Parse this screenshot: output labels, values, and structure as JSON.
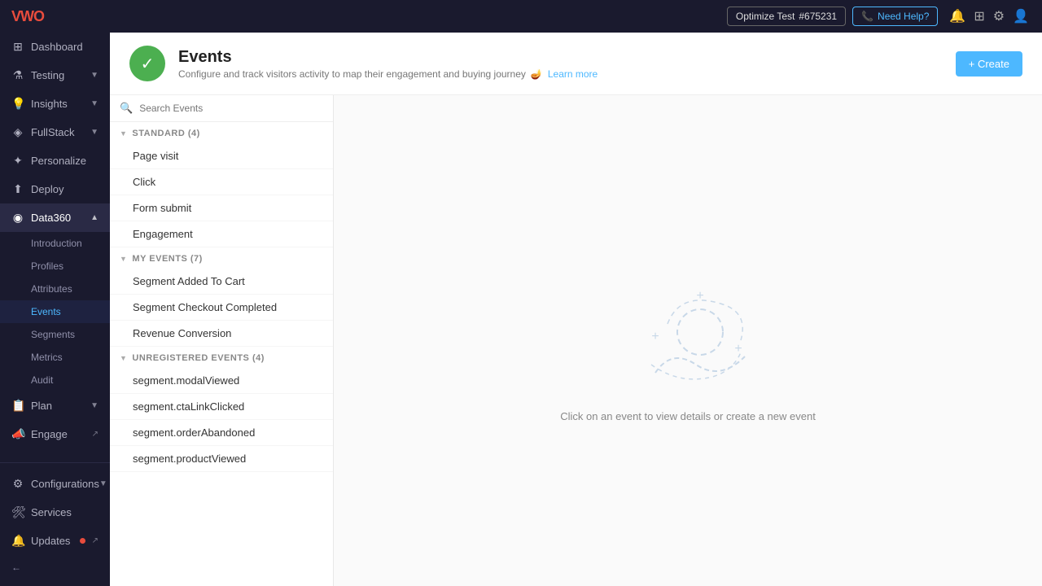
{
  "topbar": {
    "optimize_label": "Optimize Test",
    "optimize_id": "#675231",
    "need_help_label": "Need Help?",
    "phone_icon": "📞"
  },
  "sidebar": {
    "logo": "VWO",
    "items": [
      {
        "id": "dashboard",
        "label": "Dashboard",
        "icon": "⊞",
        "expandable": false
      },
      {
        "id": "testing",
        "label": "Testing",
        "icon": "⚗",
        "expandable": true
      },
      {
        "id": "insights",
        "label": "Insights",
        "icon": "💡",
        "expandable": true
      },
      {
        "id": "fullstack",
        "label": "FullStack",
        "icon": "◈",
        "expandable": true
      },
      {
        "id": "personalize",
        "label": "Personalize",
        "icon": "✦",
        "expandable": false
      },
      {
        "id": "deploy",
        "label": "Deploy",
        "icon": "⬆",
        "expandable": false
      },
      {
        "id": "data360",
        "label": "Data360",
        "icon": "◉",
        "expandable": true
      }
    ],
    "data360_sub": [
      {
        "id": "introduction",
        "label": "Introduction"
      },
      {
        "id": "profiles",
        "label": "Profiles"
      },
      {
        "id": "attributes",
        "label": "Attributes"
      },
      {
        "id": "events",
        "label": "Events",
        "active": true
      },
      {
        "id": "segments",
        "label": "Segments"
      },
      {
        "id": "metrics",
        "label": "Metrics"
      },
      {
        "id": "audit",
        "label": "Audit"
      }
    ],
    "bottom_items": [
      {
        "id": "plan",
        "label": "Plan",
        "icon": "📋",
        "expandable": true
      },
      {
        "id": "engage",
        "label": "Engage",
        "icon": "📣",
        "external": true
      },
      {
        "id": "configurations",
        "label": "Configurations",
        "icon": "⚙",
        "expandable": true
      },
      {
        "id": "services",
        "label": "Services",
        "icon": "🛠"
      },
      {
        "id": "updates",
        "label": "Updates",
        "icon": "🔔",
        "badge": true,
        "external": true
      }
    ],
    "back_label": "←"
  },
  "page": {
    "title": "Events",
    "subtitle": "Configure and track visitors activity to map their engagement and buying journey",
    "learn_more": "Learn more",
    "create_button": "+ Create",
    "icon": "✓"
  },
  "search": {
    "placeholder": "Search Events"
  },
  "sections": [
    {
      "id": "standard",
      "label": "STANDARD (4)",
      "items": [
        "Page visit",
        "Click",
        "Form submit",
        "Engagement"
      ]
    },
    {
      "id": "my-events",
      "label": "MY EVENTS (7)",
      "items": [
        "Segment Added To Cart",
        "Segment Checkout Completed",
        "Revenue Conversion"
      ]
    },
    {
      "id": "unregistered",
      "label": "UNREGISTERED EVENTS (4)",
      "items": [
        "segment.modalViewed",
        "segment.ctaLinkClicked",
        "segment.orderAbandoned",
        "segment.productViewed"
      ]
    }
  ],
  "empty_state": {
    "text": "Click on an event to view details or create a new event"
  }
}
